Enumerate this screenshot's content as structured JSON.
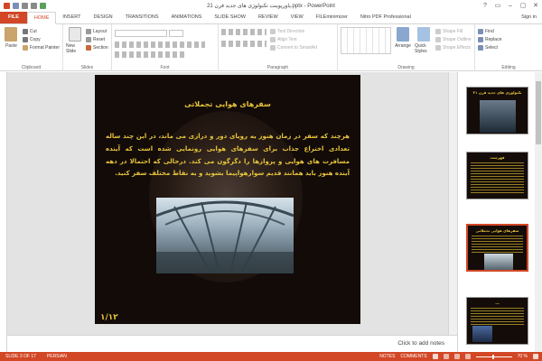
{
  "window": {
    "title": "پاورپوینت تکنولوژی های جدید قرن 21.pptx - PowerPoint",
    "controls": [
      "?",
      "▭",
      "–",
      "▢",
      "✕"
    ]
  },
  "tabs": [
    {
      "label": "FILE"
    },
    {
      "label": "HOME"
    },
    {
      "label": "INSERT"
    },
    {
      "label": "DESIGN"
    },
    {
      "label": "TRANSITIONS"
    },
    {
      "label": "ANIMATIONS"
    },
    {
      "label": "SLIDE SHOW"
    },
    {
      "label": "REVIEW"
    },
    {
      "label": "VIEW"
    },
    {
      "label": "FILEminimizer"
    },
    {
      "label": "Nitro PDF Professional"
    }
  ],
  "signin": "Sign in",
  "ribbon": {
    "clipboard": {
      "paste": "Paste",
      "cut": "Cut",
      "copy": "Copy",
      "format_painter": "Format Painter",
      "label": "Clipboard"
    },
    "slides": {
      "new_slide": "New Slide",
      "layout": "Layout",
      "reset": "Reset",
      "section": "Section",
      "label": "Slides"
    },
    "font": {
      "label": "Font"
    },
    "paragraph": {
      "text_direction": "Text Direction",
      "align_text": "Align Text",
      "convert": "Convert to SmartArt",
      "label": "Paragraph"
    },
    "drawing": {
      "arrange": "Arrange",
      "quick_styles": "Quick Styles",
      "shape_fill": "Shape Fill",
      "shape_outline": "Shape Outline",
      "shape_effects": "Shape Effects",
      "label": "Drawing"
    },
    "editing": {
      "find": "Find",
      "replace": "Replace",
      "select": "Select",
      "label": "Editing"
    }
  },
  "slide": {
    "title": "سفرهای هوایی تجملاتی",
    "body": "هرچند که سفر در زمان هنوز یه رویای دور و درازی می ماند، در این چند ساله تعدادی اختراع جذاب برای سفرهای هوایی رونمایی شده است که آینده مسافرت های هوایی و پروازها را دگرگون می کند. درحالی که احتمالا در دهه آینده هنوز باید همانند قدیم سوارهواپیما بشوید و به نقاط مختلف سفر کنید.",
    "page": "۱/۱۲"
  },
  "thumbnails": [
    {
      "num": "1",
      "title": "تکنولوژی های جدید قرن ۲۱"
    },
    {
      "num": "2",
      "title": "فهرست"
    },
    {
      "num": "3",
      "title": "سفرهای هوایی تجملاتی"
    },
    {
      "num": "4",
      "title": "..."
    }
  ],
  "notes_placeholder": "Click to add notes",
  "status": {
    "slide": "SLIDE 3 OF 17",
    "language": "PERSIAN",
    "notes": "NOTES",
    "comments": "COMMENTS",
    "zoom": "70 %"
  },
  "colors": {
    "accent": "#d24726",
    "slide_text": "#e8c43a"
  }
}
